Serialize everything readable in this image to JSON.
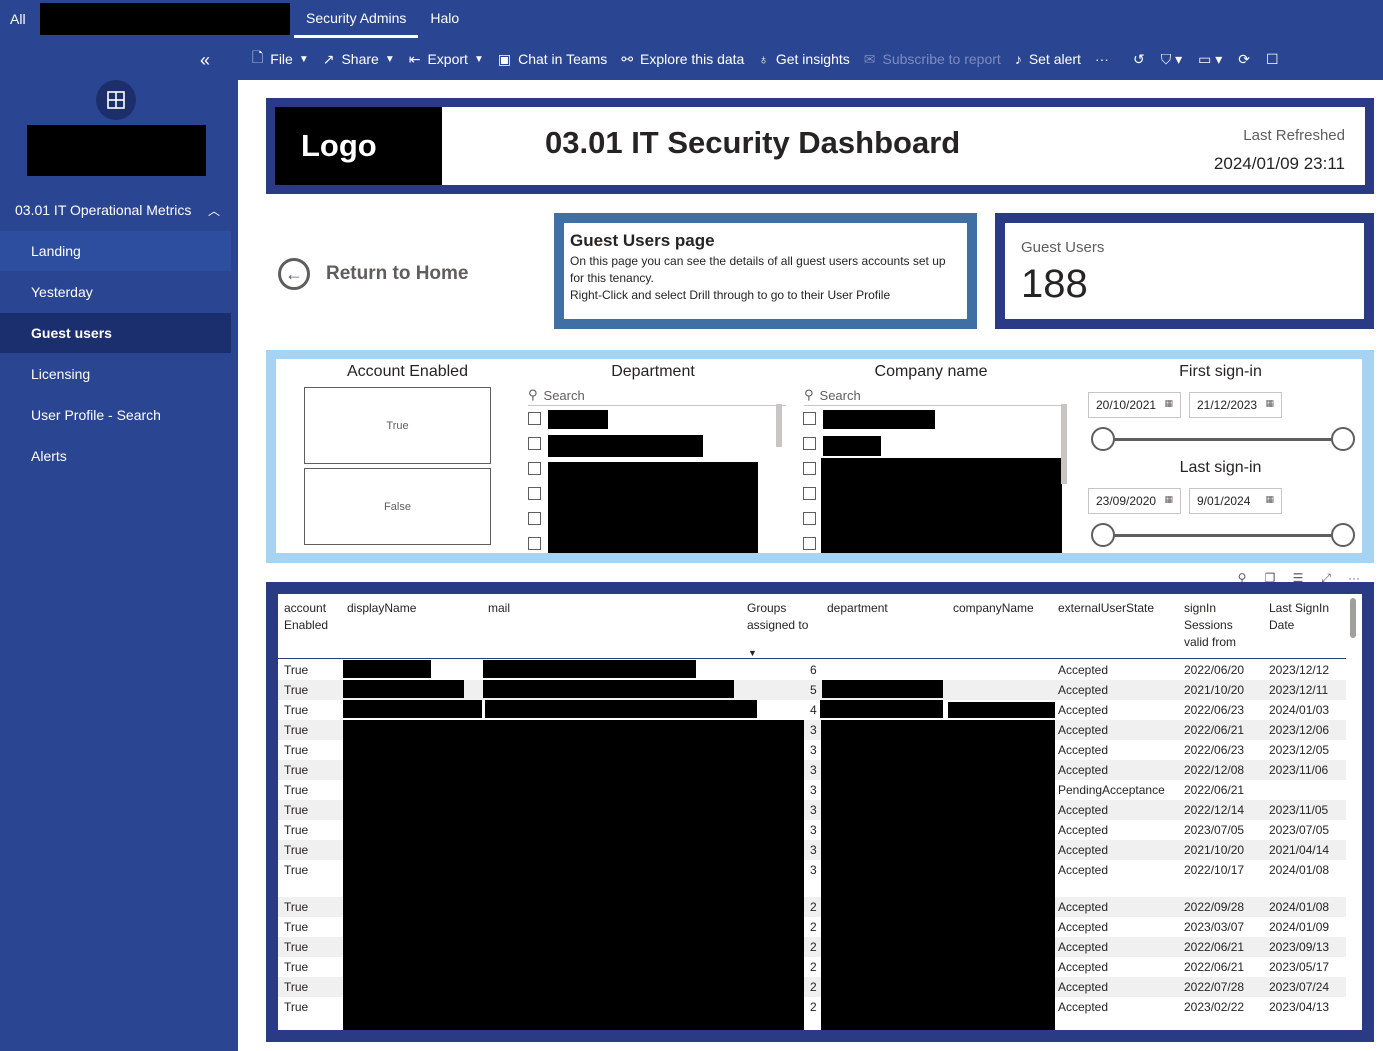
{
  "topbar": {
    "all": "All",
    "tabs": [
      "Security Admins",
      "Halo"
    ]
  },
  "nav": {
    "section": "03.01 IT Operational Metrics",
    "items": [
      "Landing",
      "Yesterday",
      "Guest users",
      "Licensing",
      "User Profile - Search",
      "Alerts"
    ]
  },
  "toolbar": {
    "file": "File",
    "share": "Share",
    "export": "Export",
    "chat": "Chat in Teams",
    "explore": "Explore this data",
    "insights": "Get insights",
    "subscribe": "Subscribe to report",
    "alert": "Set alert",
    "more": "···"
  },
  "header": {
    "logo": "Logo",
    "title": "03.01 IT Security Dashboard",
    "refreshed_label": "Last Refreshed",
    "refreshed_value": "2024/01/09 23:11"
  },
  "home": {
    "label": "Return to Home"
  },
  "guest_page": {
    "title": "Guest Users page",
    "line1": "On this page you can see the details of all guest users accounts set up for this tenancy.",
    "line2": "Right-Click and select Drill through to go to their User Profile"
  },
  "kpi": {
    "label": "Guest Users",
    "value": "188"
  },
  "slicers": {
    "account_enabled": {
      "title": "Account Enabled",
      "options": [
        "True",
        "False"
      ]
    },
    "department": {
      "title": "Department",
      "search": "Search"
    },
    "company": {
      "title": "Company name",
      "search": "Search"
    },
    "first_signin": {
      "title": "First sign-in",
      "from": "20/10/2021",
      "to": "21/12/2023"
    },
    "last_signin": {
      "title": "Last sign-in",
      "from": "23/09/2020",
      "to": "9/01/2024"
    }
  },
  "table": {
    "headers": {
      "enabled": "account Enabled",
      "display": "displayName",
      "mail": "mail",
      "groups": "Groups assigned to",
      "dept": "department",
      "company": "companyName",
      "state": "externalUserState",
      "valid": "signIn Sessions valid from",
      "last": "Last SignIn Date"
    },
    "rows": [
      {
        "e": "True",
        "g": "6",
        "s": "Accepted",
        "v": "2022/06/20",
        "l": "2023/12/12"
      },
      {
        "e": "True",
        "g": "5",
        "s": "Accepted",
        "v": "2021/10/20",
        "l": "2023/12/11"
      },
      {
        "e": "True",
        "g": "4",
        "s": "Accepted",
        "v": "2022/06/23",
        "l": "2024/01/03"
      },
      {
        "e": "True",
        "g": "3",
        "s": "Accepted",
        "v": "2022/06/21",
        "l": "2023/12/06"
      },
      {
        "e": "True",
        "g": "3",
        "s": "Accepted",
        "v": "2022/06/23",
        "l": "2023/12/05"
      },
      {
        "e": "True",
        "g": "3",
        "s": "Accepted",
        "v": "2022/12/08",
        "l": "2023/11/06"
      },
      {
        "e": "True",
        "g": "3",
        "s": "PendingAcceptance",
        "v": "2022/06/21",
        "l": ""
      },
      {
        "e": "True",
        "g": "3",
        "s": "Accepted",
        "v": "2022/12/14",
        "l": "2023/11/05"
      },
      {
        "e": "True",
        "g": "3",
        "s": "Accepted",
        "v": "2023/07/05",
        "l": "2023/07/05"
      },
      {
        "e": "True",
        "g": "3",
        "s": "Accepted",
        "v": "2021/10/20",
        "l": "2021/04/14"
      },
      {
        "e": "True",
        "g": "3",
        "s": "Accepted",
        "v": "2022/10/17",
        "l": "2024/01/08"
      },
      {
        "e": "True",
        "g": "2",
        "s": "Accepted",
        "v": "2022/09/28",
        "l": "2024/01/08"
      },
      {
        "e": "True",
        "g": "2",
        "s": "Accepted",
        "v": "2023/03/07",
        "l": "2024/01/09"
      },
      {
        "e": "True",
        "g": "2",
        "s": "Accepted",
        "v": "2022/06/21",
        "l": "2023/09/13"
      },
      {
        "e": "True",
        "g": "2",
        "s": "Accepted",
        "v": "2022/06/21",
        "l": "2023/05/17"
      },
      {
        "e": "True",
        "g": "2",
        "s": "Accepted",
        "v": "2022/07/28",
        "l": "2023/07/24"
      },
      {
        "e": "True",
        "g": "2",
        "s": "Accepted",
        "v": "2023/02/22",
        "l": "2023/04/13"
      }
    ]
  }
}
